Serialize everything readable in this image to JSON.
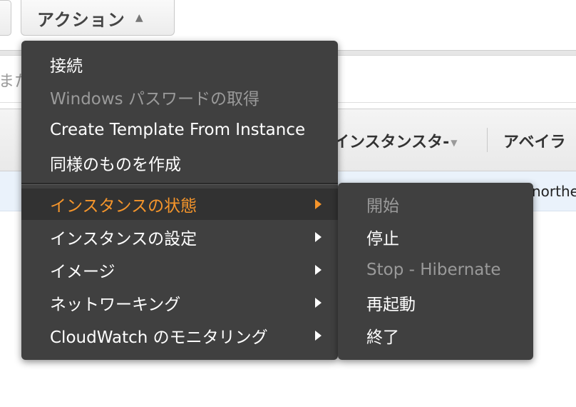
{
  "toolbar": {
    "action_button": "アクション",
    "action_caret": "▲"
  },
  "search": {
    "partial_text": "また"
  },
  "table": {
    "headers": {
      "instance_state": "インスタンスタ-",
      "availability_zone": "アベイラ"
    },
    "row_cell_partial": "northe"
  },
  "menu": {
    "items": [
      {
        "label": "接続",
        "enabled": true,
        "submenu": false
      },
      {
        "label": "Windows パスワードの取得",
        "enabled": false,
        "submenu": false
      },
      {
        "label": "Create Template From Instance",
        "enabled": true,
        "submenu": false
      },
      {
        "label": "同様のものを作成",
        "enabled": true,
        "submenu": false
      },
      {
        "label": "インスタンスの状態",
        "enabled": true,
        "submenu": true,
        "active": true
      },
      {
        "label": "インスタンスの設定",
        "enabled": true,
        "submenu": true
      },
      {
        "label": "イメージ",
        "enabled": true,
        "submenu": true
      },
      {
        "label": "ネットワーキング",
        "enabled": true,
        "submenu": true
      },
      {
        "label": "CloudWatch のモニタリング",
        "enabled": true,
        "submenu": true
      }
    ]
  },
  "submenu": {
    "items": [
      {
        "label": "開始",
        "enabled": false
      },
      {
        "label": "停止",
        "enabled": true
      },
      {
        "label": "Stop - Hibernate",
        "enabled": false
      },
      {
        "label": "再起動",
        "enabled": true
      },
      {
        "label": "終了",
        "enabled": true
      }
    ]
  },
  "colors": {
    "menu_bg": "#404040",
    "active_text": "#f5952b",
    "disabled_text": "#9a9a9a"
  }
}
